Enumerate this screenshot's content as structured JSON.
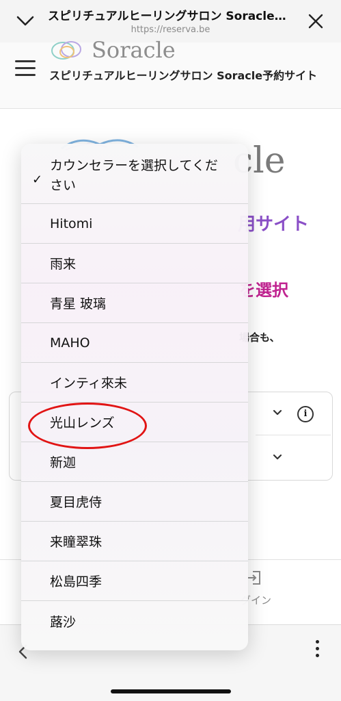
{
  "browser": {
    "title": "スピリチュアルヒーリングサロン Soracle予約サイト",
    "url": "https://reserva.be"
  },
  "site": {
    "logo_text": "Soracle",
    "title": "スピリチュアルヒーリングサロン Soracle予約サイト"
  },
  "page": {
    "big_logo_text": "cle",
    "subtitle_fragment": "用サイト",
    "select_heading_fragment": "を選択",
    "note_fragment": "場合も、",
    "login_label": "グイン"
  },
  "picker": {
    "selected_label": "カウンセラーを選択してください",
    "options": [
      "Hitomi",
      "雨来",
      "青星 玻璃",
      "MAHO",
      "インティ來未",
      "光山レンズ",
      "新迦",
      "夏目虎侍",
      "来瞳翠珠",
      "松島四季",
      "蕗沙"
    ],
    "circled_option": "光山レンズ"
  },
  "colors": {
    "accent_purple": "#8a4fc7",
    "accent_magenta": "#c02390",
    "highlight_red": "#e11414"
  }
}
